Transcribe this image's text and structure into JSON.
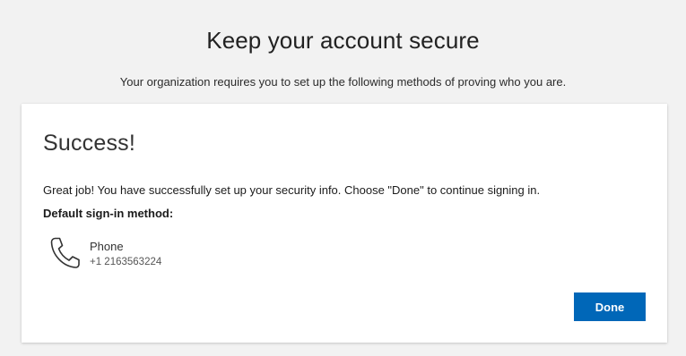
{
  "header": {
    "title": "Keep your account secure",
    "subtitle": "Your organization requires you to set up the following methods of proving who you are."
  },
  "card": {
    "heading": "Success!",
    "message": "Great job! You have successfully set up your security info. Choose \"Done\" to continue signing in.",
    "default_method_label": "Default sign-in method:",
    "method": {
      "icon": "phone-icon",
      "name": "Phone",
      "value": "+1 2163563224"
    },
    "done_label": "Done"
  },
  "colors": {
    "page_background": "#f2f2f2",
    "card_background": "#ffffff",
    "primary_button": "#0067b8"
  }
}
